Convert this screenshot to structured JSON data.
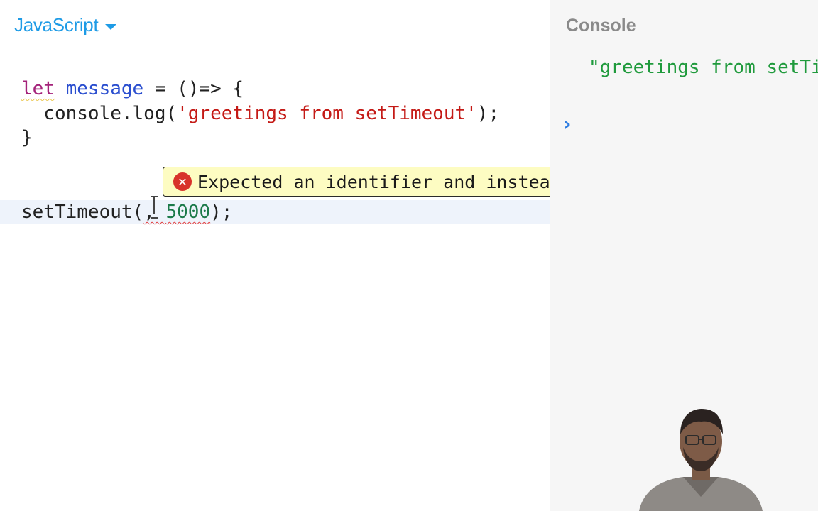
{
  "editor": {
    "language": "JavaScript",
    "code": {
      "line1": {
        "kw": "let",
        "sp1": " ",
        "name": "message",
        "rest": " = ()=> {"
      },
      "line2": {
        "pre": "  console.log(",
        "str": "'greetings from setTimeout'",
        "post": ");"
      },
      "line3": {
        "text": "}"
      },
      "line4": {
        "fn": "setTimeout(",
        "err": ", 5000",
        "num": "5000",
        "close": ");"
      }
    },
    "error_tooltip": {
      "icon": "x-circle-icon",
      "message": "Expected an identifier and instead saw ','."
    }
  },
  "console": {
    "title": "Console",
    "output": "\"greetings from setTimeout'",
    "prompt_symbol": "›"
  },
  "colors": {
    "accent": "#1e9be6",
    "string": "#c41a16",
    "keyword": "#a4227a",
    "number": "#1c7a4a",
    "console_output": "#1f9a3c",
    "error": "#d8322b",
    "tooltip_bg": "#fdfcc2"
  }
}
